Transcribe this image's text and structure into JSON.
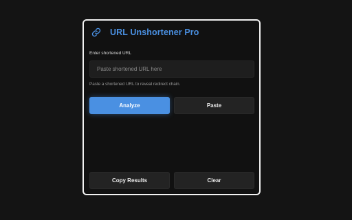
{
  "app": {
    "title": "URL Unshortener Pro",
    "accent_color": "#4a90e2",
    "icon": "link-icon"
  },
  "input": {
    "label": "Enter shortened URL",
    "placeholder": "Paste shortened URL here",
    "value": "",
    "hint": "Paste a shortened URL to reveal redirect chain."
  },
  "buttons": {
    "analyze": "Analyze",
    "paste": "Paste",
    "copy_results": "Copy Results",
    "clear": "Clear"
  }
}
